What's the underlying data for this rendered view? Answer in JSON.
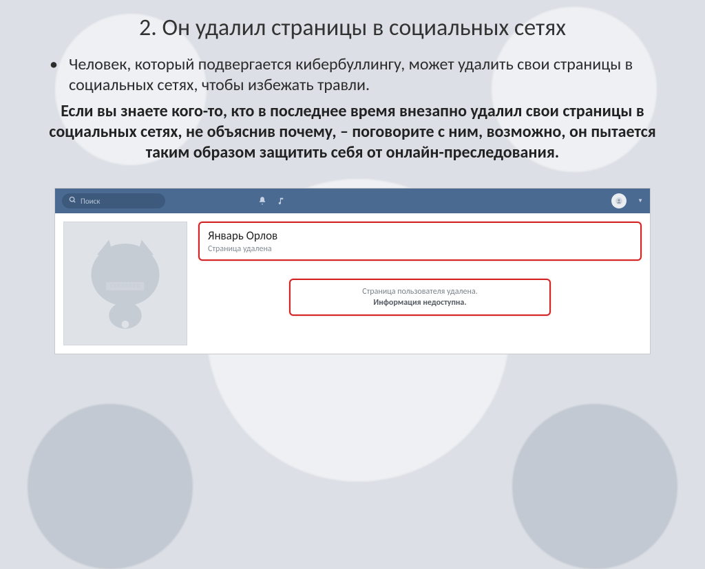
{
  "title": "2. Он удалил страницы в социальных сетях",
  "bullet1": "Человек, который подвергается кибербуллингу, может удалить свои страницы в социальных сетях, чтобы избежать травли.",
  "emph": "Если вы знаете кого-то, кто в последнее время внезапно удалил свои страницы в социальных сетях, не объяснив почему, – поговорите с ним, возможно, он пытается таким образом защитить себя от онлайн-преследования.",
  "vk": {
    "search_placeholder": "Поиск",
    "censored_label": "CENSORED",
    "profile_name": "Январь Орлов",
    "profile_status": "Страница удалена",
    "deleted_line1": "Страница пользователя удалена.",
    "deleted_line2": "Информация недоступна."
  }
}
